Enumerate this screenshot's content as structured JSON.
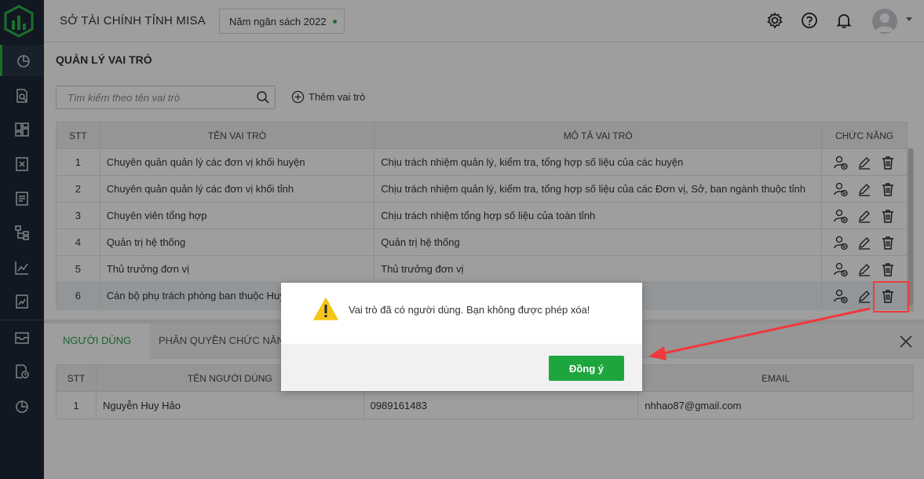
{
  "header": {
    "org_title": "SỞ TÀI CHÍNH TỈNH MISA",
    "year_selector": "Năm ngân sách 2022",
    "icons": [
      "gear-icon",
      "help-icon",
      "bell-icon",
      "avatar"
    ]
  },
  "sidebar": {
    "items": [
      "dashboard-icon",
      "search-doc-icon",
      "grid-icon",
      "excel-icon",
      "report-icon",
      "org-chart-icon",
      "line-chart-icon",
      "chart-doc-icon",
      "inbox-icon",
      "time-doc-icon",
      "pie-chart-icon"
    ]
  },
  "main": {
    "title": "QUẢN LÝ VAI TRÒ",
    "search_placeholder": "Tìm kiếm theo tên vai trò",
    "add_role_label": "Thêm vai trò",
    "role_table": {
      "columns": [
        "STT",
        "TÊN VAI TRÒ",
        "MÔ TẢ VAI TRÒ",
        "CHỨC NĂNG"
      ],
      "rows": [
        {
          "stt": "1",
          "name": "Chuyên quản quản lý các đơn vị khối huyện",
          "desc": "Chịu trách nhiệm quản lý, kiểm tra, tổng hợp số liệu của các huyện"
        },
        {
          "stt": "2",
          "name": "Chuyên quản quản lý các đơn vị khối tỉnh",
          "desc": "Chịu trách nhiệm quản lý, kiểm tra, tổng hợp số liệu của các Đơn vị, Sở, ban ngành thuộc tỉnh"
        },
        {
          "stt": "3",
          "name": "Chuyên viên tổng hợp",
          "desc": "Chịu trách nhiệm tổng hợp số liệu của toàn tỉnh"
        },
        {
          "stt": "4",
          "name": "Quản trị hệ thống",
          "desc": "Quản trị hệ thống"
        },
        {
          "stt": "5",
          "name": "Thủ trưởng đơn vị",
          "desc": "Thủ trưởng đơn vị"
        },
        {
          "stt": "6",
          "name": "Cán bộ phụ trách phòng ban thuộc Huy",
          "desc": ""
        }
      ]
    },
    "tabs": [
      "NGƯỜI DÙNG",
      "PHÂN QUYỀN CHỨC NĂNG"
    ],
    "user_table": {
      "columns": [
        "STT",
        "TÊN NGƯỜI DÙNG",
        "",
        "EMAIL"
      ],
      "rows": [
        {
          "stt": "1",
          "name": "Nguyễn Huy Hảo",
          "phone": "0989161483",
          "email": "nhhao87@gmail.com"
        }
      ]
    }
  },
  "dialog": {
    "message": "Vai trò đã có người dùng. Bạn không được phép xóa!",
    "ok_label": "Đồng ý"
  },
  "colors": {
    "sidebar_bg": "#1d2836",
    "accent_green": "#2cb34a",
    "button_green": "#1da63d",
    "annotation_red": "#f0393d",
    "warning_yellow": "#f5c518"
  }
}
